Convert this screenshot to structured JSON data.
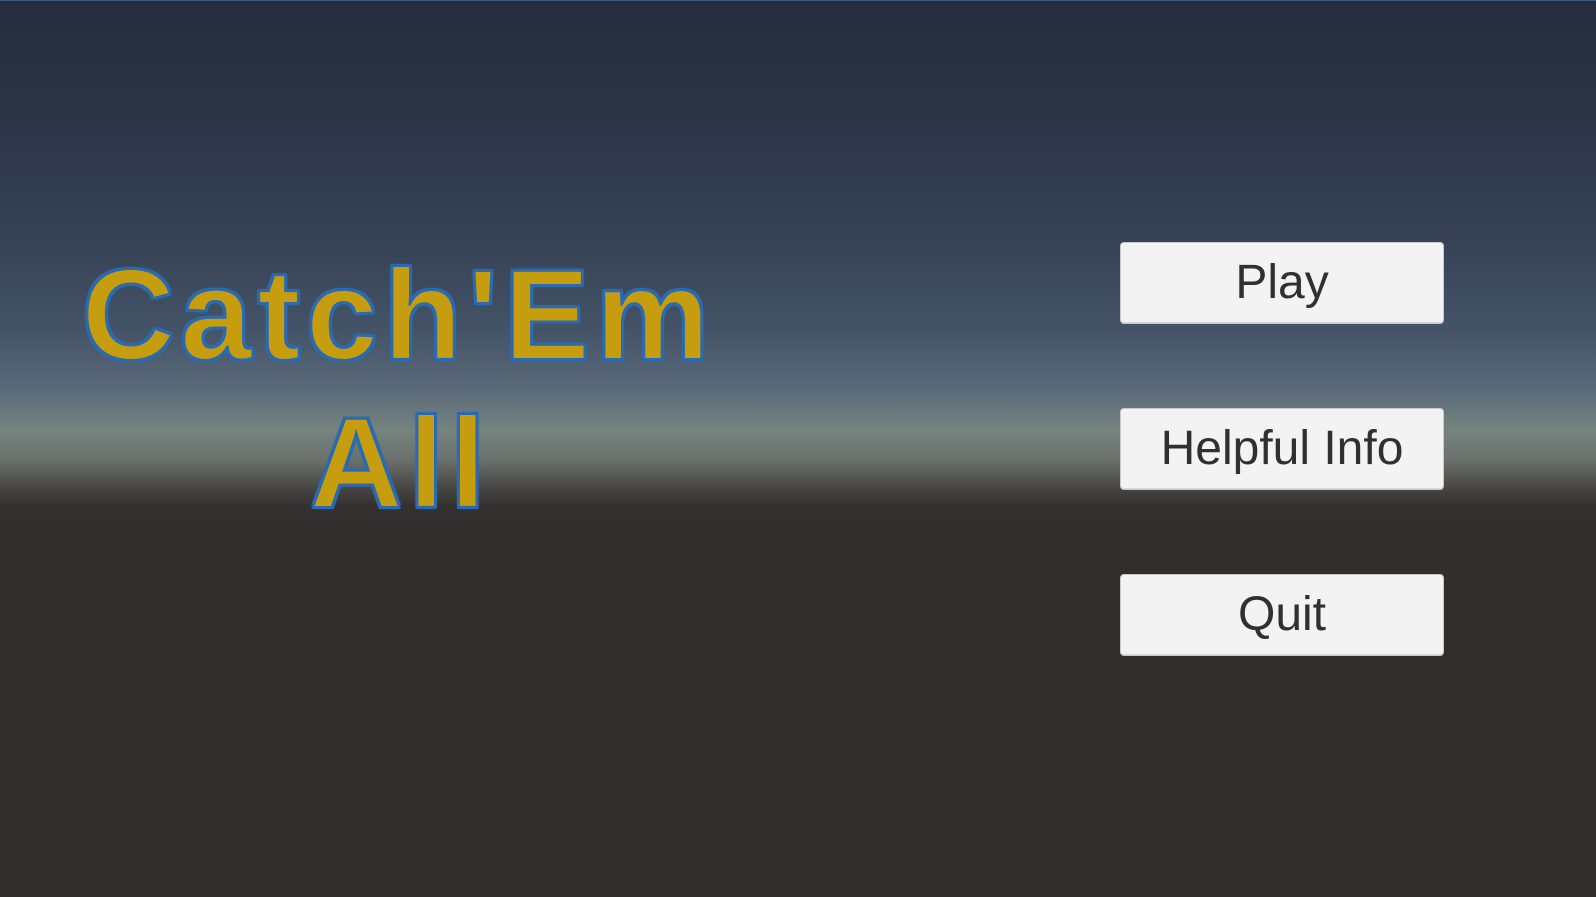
{
  "title": {
    "line1": "Catch'Em",
    "line2": "All"
  },
  "menu": {
    "play_label": "Play",
    "info_label": "Helpful Info",
    "quit_label": "Quit"
  },
  "colors": {
    "title_fill": "#c59d0f",
    "title_outline": "#2a6ab0",
    "button_bg": "#f3f3f3",
    "button_text": "#303030",
    "sky_top": "#262d3c",
    "horizon": "#76847f",
    "ground": "#312e2c"
  }
}
